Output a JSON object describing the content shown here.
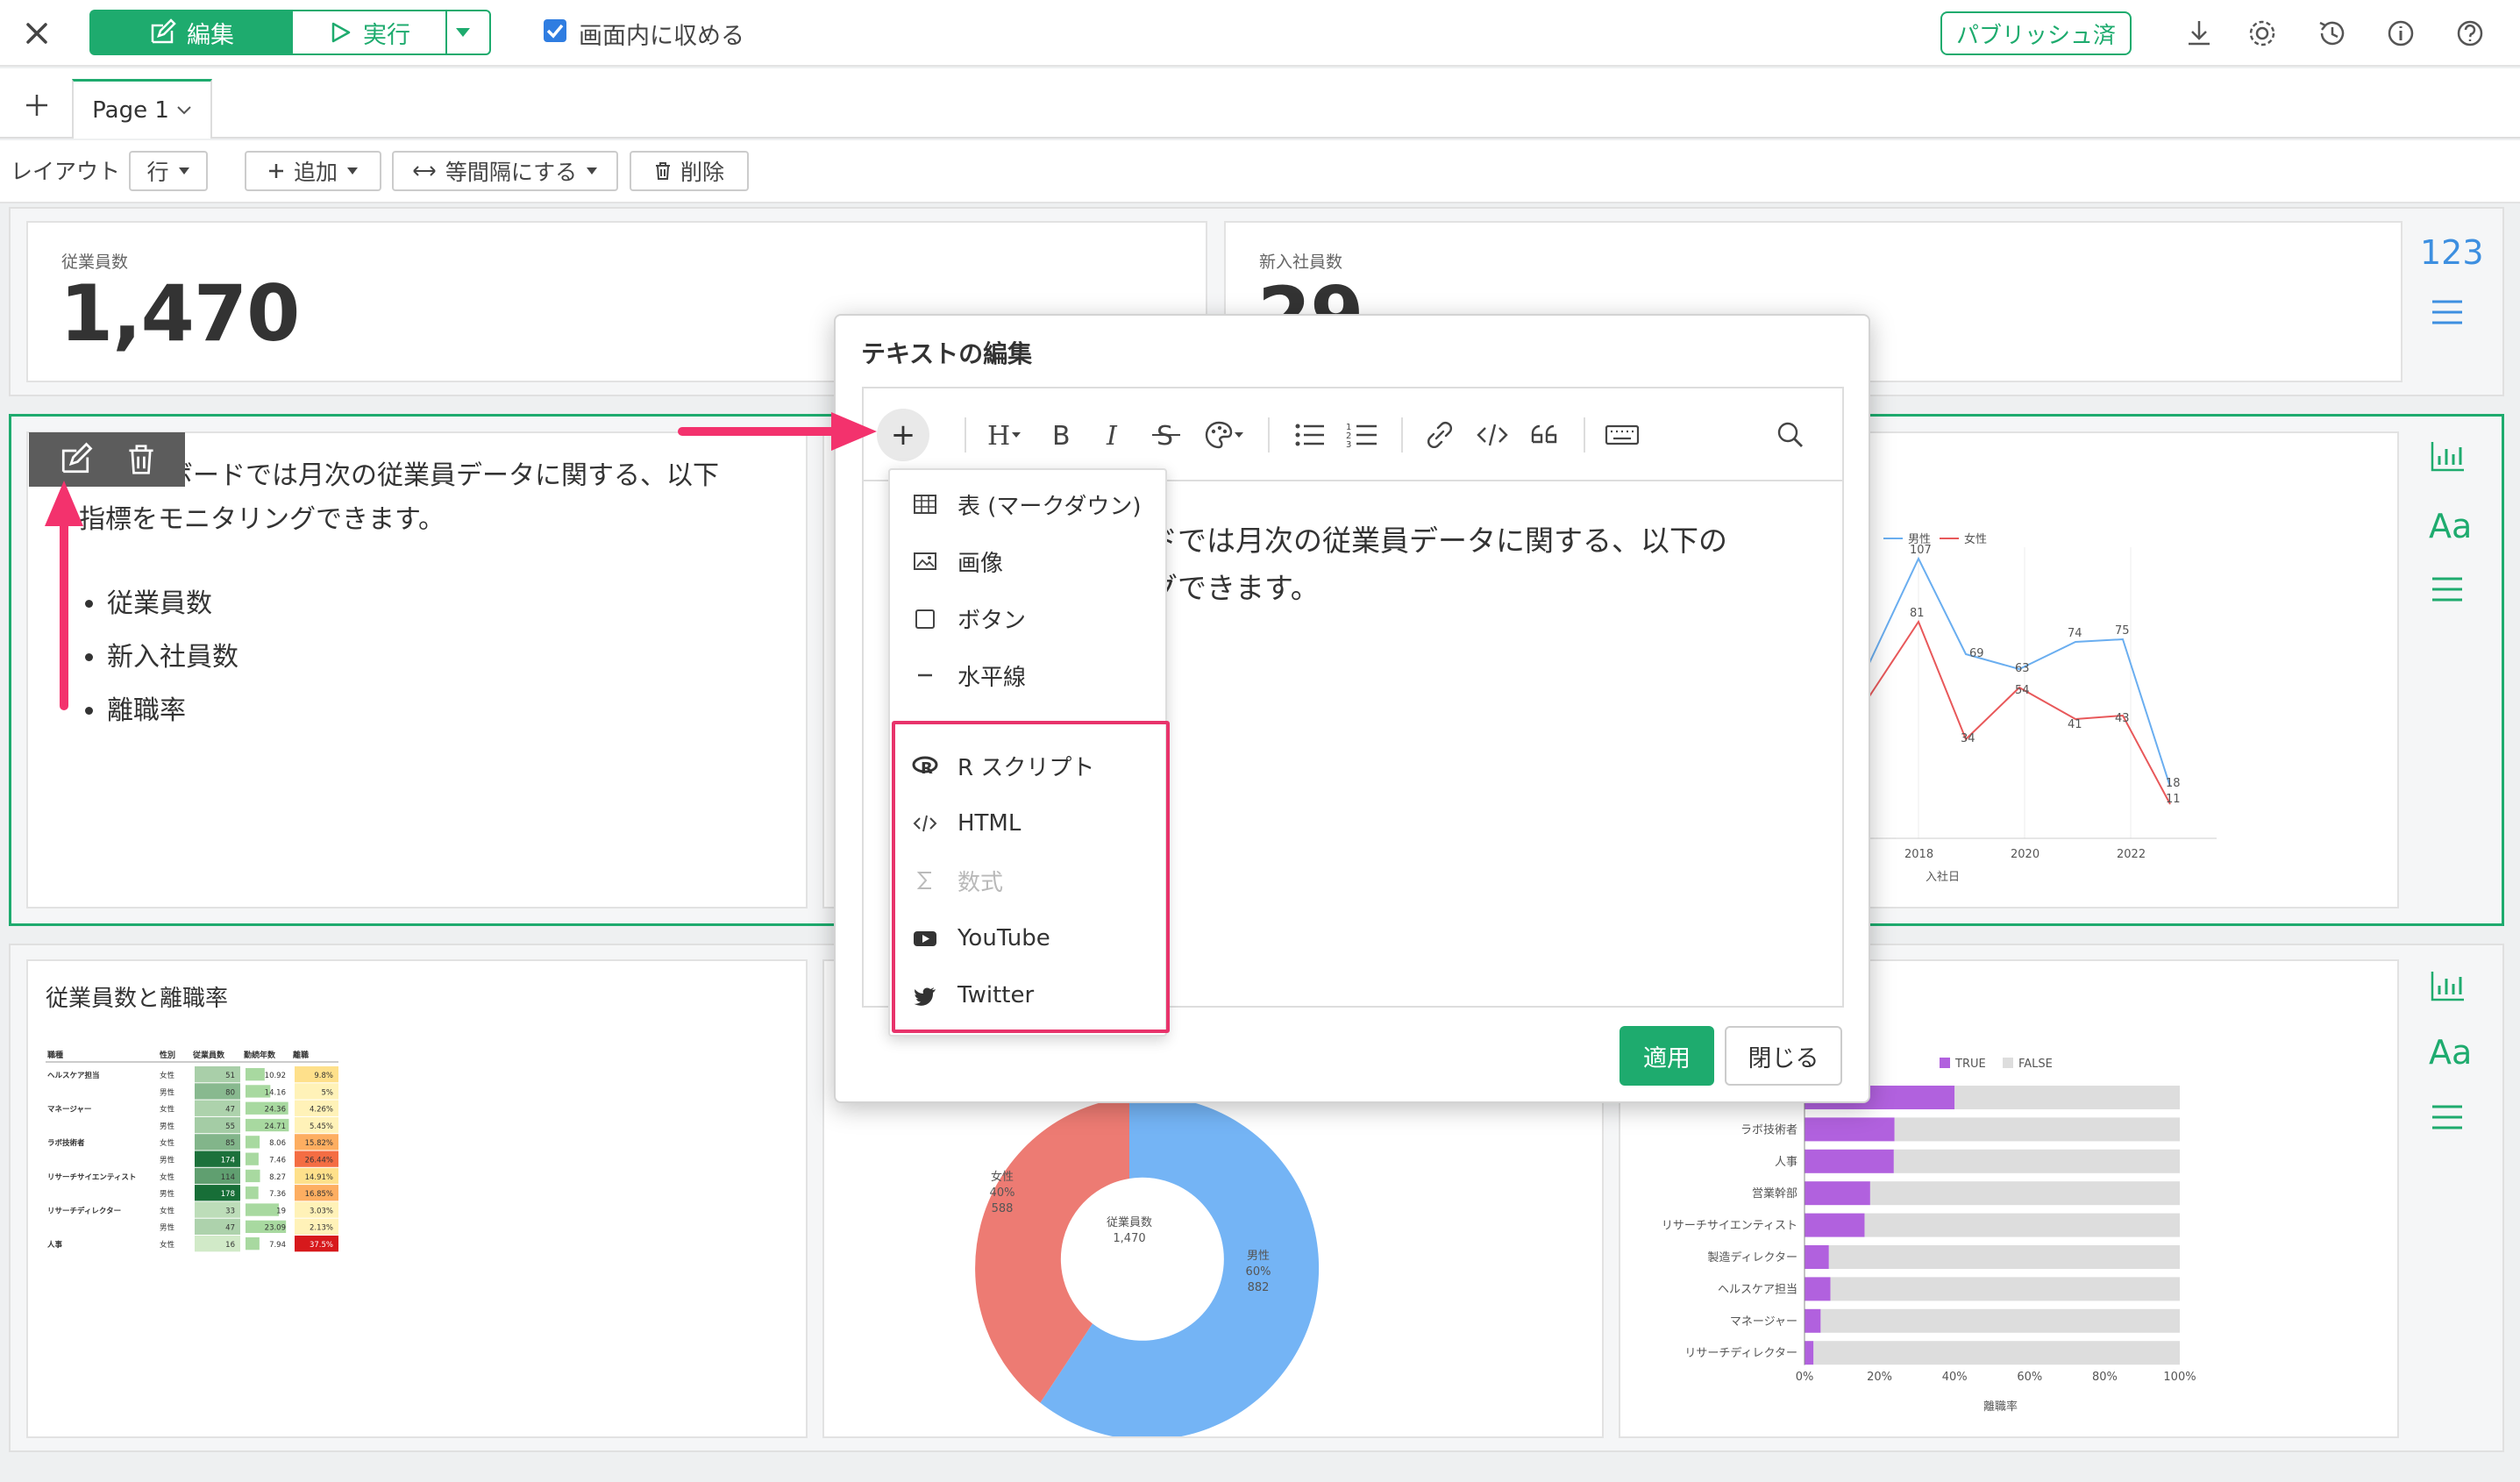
{
  "topbar": {
    "edit_label": "編集",
    "run_label": "実行",
    "fit_label": "画面内に収める",
    "publish_label": "パブリッシュ済"
  },
  "tabs": {
    "page_tab": "Page 1"
  },
  "layout_toolbar": {
    "label": "レイアウト",
    "row_label": "行",
    "add_label": "追加",
    "equal_label": "等間隔にする",
    "delete_label": "削除"
  },
  "kpi": [
    {
      "label": "従業員数",
      "value": "1,470"
    },
    {
      "label": "新入社員数",
      "value": "29"
    }
  ],
  "row1_side": {
    "number_icon_text": "123"
  },
  "text_card": {
    "line1": "ュボードでは月次の従業員データに関する、以下",
    "line2": "指標をモニタリングできます。",
    "bullets": [
      "従業員数",
      "新入社員数",
      "離職率"
    ]
  },
  "modal": {
    "title": "テキストの編集",
    "text_line1": "ドでは月次の従業員データに関する、以下の",
    "text_line2": "グできます。",
    "apply_label": "適用",
    "close_label": "閉じる"
  },
  "insert_menu": {
    "items": [
      "表 (マークダウン)",
      "画像",
      "ボタン",
      "水平線"
    ],
    "highlighted": [
      "R スクリプト",
      "HTML",
      "数式",
      "YouTube",
      "Twitter"
    ]
  },
  "line_chart": {
    "legend": [
      "男性",
      "女性"
    ],
    "x_ticks": [
      "2018",
      "2020",
      "2022"
    ],
    "x_label": "入社日",
    "male_labels": [
      "107",
      "69",
      "63",
      "74",
      "75",
      "18"
    ],
    "female_labels": [
      "81",
      "34",
      "54",
      "41",
      "43",
      "11"
    ],
    "colors": {
      "male": "#6aaef0",
      "female": "#e8585a"
    }
  },
  "heatmap_card": {
    "title": "従業員数と離職率",
    "headers": [
      "職種",
      "性別",
      "従業員数",
      "勤続年数",
      "離職"
    ],
    "rows": [
      [
        "ヘルスケア担当",
        "女性",
        "51",
        "10.92",
        "9.8%"
      ],
      [
        "",
        "男性",
        "80",
        "14.16",
        "5%"
      ],
      [
        "マネージャー",
        "女性",
        "47",
        "24.36",
        "4.26%"
      ],
      [
        "",
        "男性",
        "55",
        "24.71",
        "5.45%"
      ],
      [
        "ラボ技術者",
        "女性",
        "85",
        "8.06",
        "15.82%"
      ],
      [
        "",
        "男性",
        "174",
        "7.46",
        "26.44%"
      ],
      [
        "リサーチサイエンティスト",
        "女性",
        "114",
        "8.27",
        "14.91%"
      ],
      [
        "",
        "男性",
        "178",
        "7.36",
        "16.85%"
      ],
      [
        "リサーチディレクター",
        "女性",
        "33",
        "19",
        "3.03%"
      ],
      [
        "",
        "男性",
        "47",
        "23.09",
        "2.13%"
      ],
      [
        "人事",
        "女性",
        "16",
        "7.94",
        "37.5%"
      ]
    ]
  },
  "donut": {
    "center_label": "従業員数",
    "center_value": "1,470",
    "female_label": "女性",
    "female_pct": "40%",
    "female_value": "588",
    "male_label": "男性",
    "male_pct": "60%",
    "male_value": "882"
  },
  "bar_chart": {
    "legend": [
      "TRUE",
      "FALSE"
    ],
    "categories": [
      "ラボ技術者",
      "人事",
      "営業幹部",
      "リサーチサイエンティスト",
      "製造ディレクター",
      "ヘルスケア担当",
      "マネージャー",
      "リサーチディレクター"
    ],
    "x_ticks": [
      "0%",
      "20%",
      "40%",
      "60%",
      "80%",
      "100%"
    ],
    "x_label": "離職率",
    "colors": {
      "true": "#b161de",
      "false": "#dddddd"
    }
  },
  "chart_data": [
    {
      "type": "line",
      "x_label": "入社日",
      "series": [
        {
          "name": "男性",
          "values": [
            107,
            69,
            63,
            74,
            75,
            18
          ]
        },
        {
          "name": "女性",
          "values": [
            81,
            34,
            54,
            41,
            43,
            11
          ]
        }
      ]
    },
    {
      "type": "pie",
      "categories": [
        "女性",
        "男性"
      ],
      "values": [
        588,
        882
      ]
    },
    {
      "type": "bar",
      "categories": [
        "",
        "ラボ技術者",
        "人事",
        "営業幹部",
        "リサーチサイエンティスト",
        "製造ディレクター",
        "ヘルスケア担当",
        "マネージャー",
        "リサーチディレクター"
      ],
      "series": [
        {
          "name": "TRUE",
          "values": [
            40,
            24,
            23.8,
            17.5,
            16,
            6.5,
            6.9,
            4.3,
            2.4
          ]
        },
        {
          "name": "FALSE",
          "values": [
            60,
            76,
            76.2,
            82.5,
            84,
            93.5,
            93.1,
            95.7,
            97.6
          ]
        }
      ],
      "x_label": "離職率",
      "xlim": [
        0,
        100
      ]
    }
  ]
}
